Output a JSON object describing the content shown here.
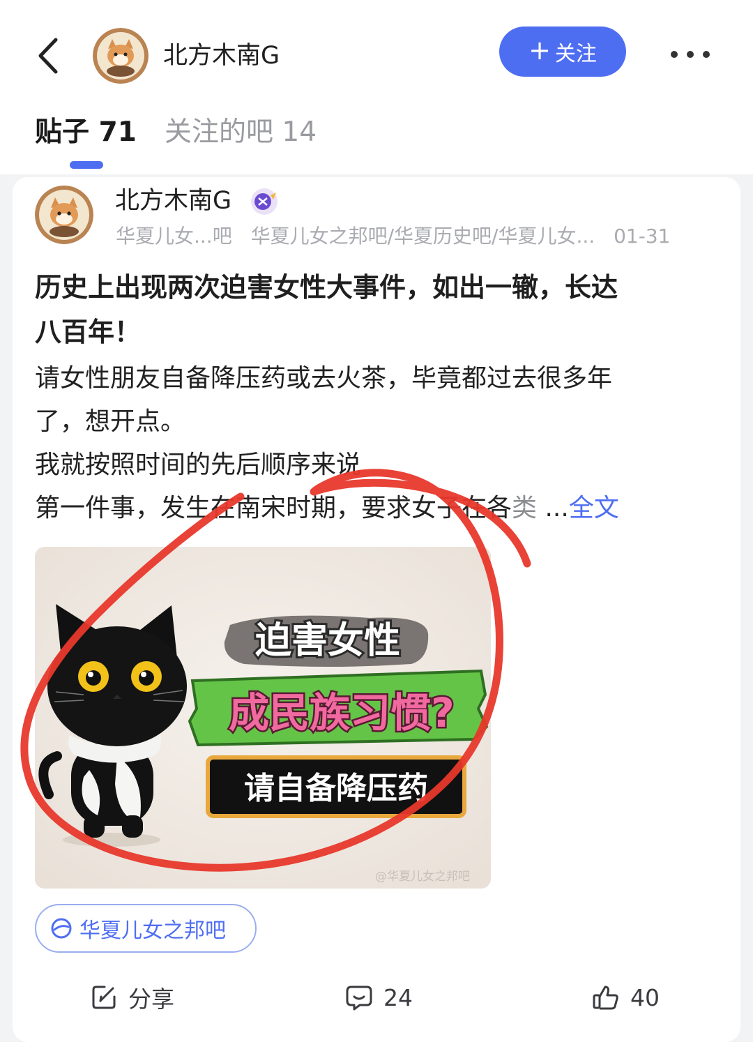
{
  "header": {
    "username": "北方木南G",
    "follow_label": "关注",
    "tabs": [
      {
        "label": "贴子 71",
        "active": true
      },
      {
        "label": "关注的吧 14",
        "active": false
      }
    ]
  },
  "post": {
    "author": "北方木南G",
    "meta": {
      "bar_short": "华夏儿女...吧",
      "bars": "华夏儿女之邦吧/华夏历史吧/华夏儿女...",
      "date": "01-31"
    },
    "title_line1": "历史上出现两次迫害女性大事件，如出一辙，长达",
    "title_line2": "八百年！",
    "body_lines": [
      "请女性朋友自备降压药或去火茶，毕竟都过去很多年",
      "了，想开点。",
      "我就按照时间的先后顺序来说"
    ],
    "last_line": "第一件事，发生在南宋时期，要求女子在各",
    "last_line_fade": "类",
    "ellipsis": " ...",
    "full_text_label": "全文",
    "image": {
      "title": "迫害女性",
      "subtitle": "成民族习惯?",
      "banner": "请自备降压药",
      "watermark": "@华夏儿女之邦吧"
    },
    "tag": "华夏儿女之邦吧",
    "actions": {
      "share_label": "分享",
      "comments": "24",
      "likes": "40"
    }
  },
  "colors": {
    "accent": "#4e6ef2",
    "annotation": "#e8382b",
    "background": "#f2f3f5"
  },
  "icons": [
    "back-arrow-icon",
    "more-icon",
    "plus-icon",
    "badge-icon",
    "bar-tag-icon",
    "share-icon",
    "comment-icon",
    "like-icon"
  ]
}
